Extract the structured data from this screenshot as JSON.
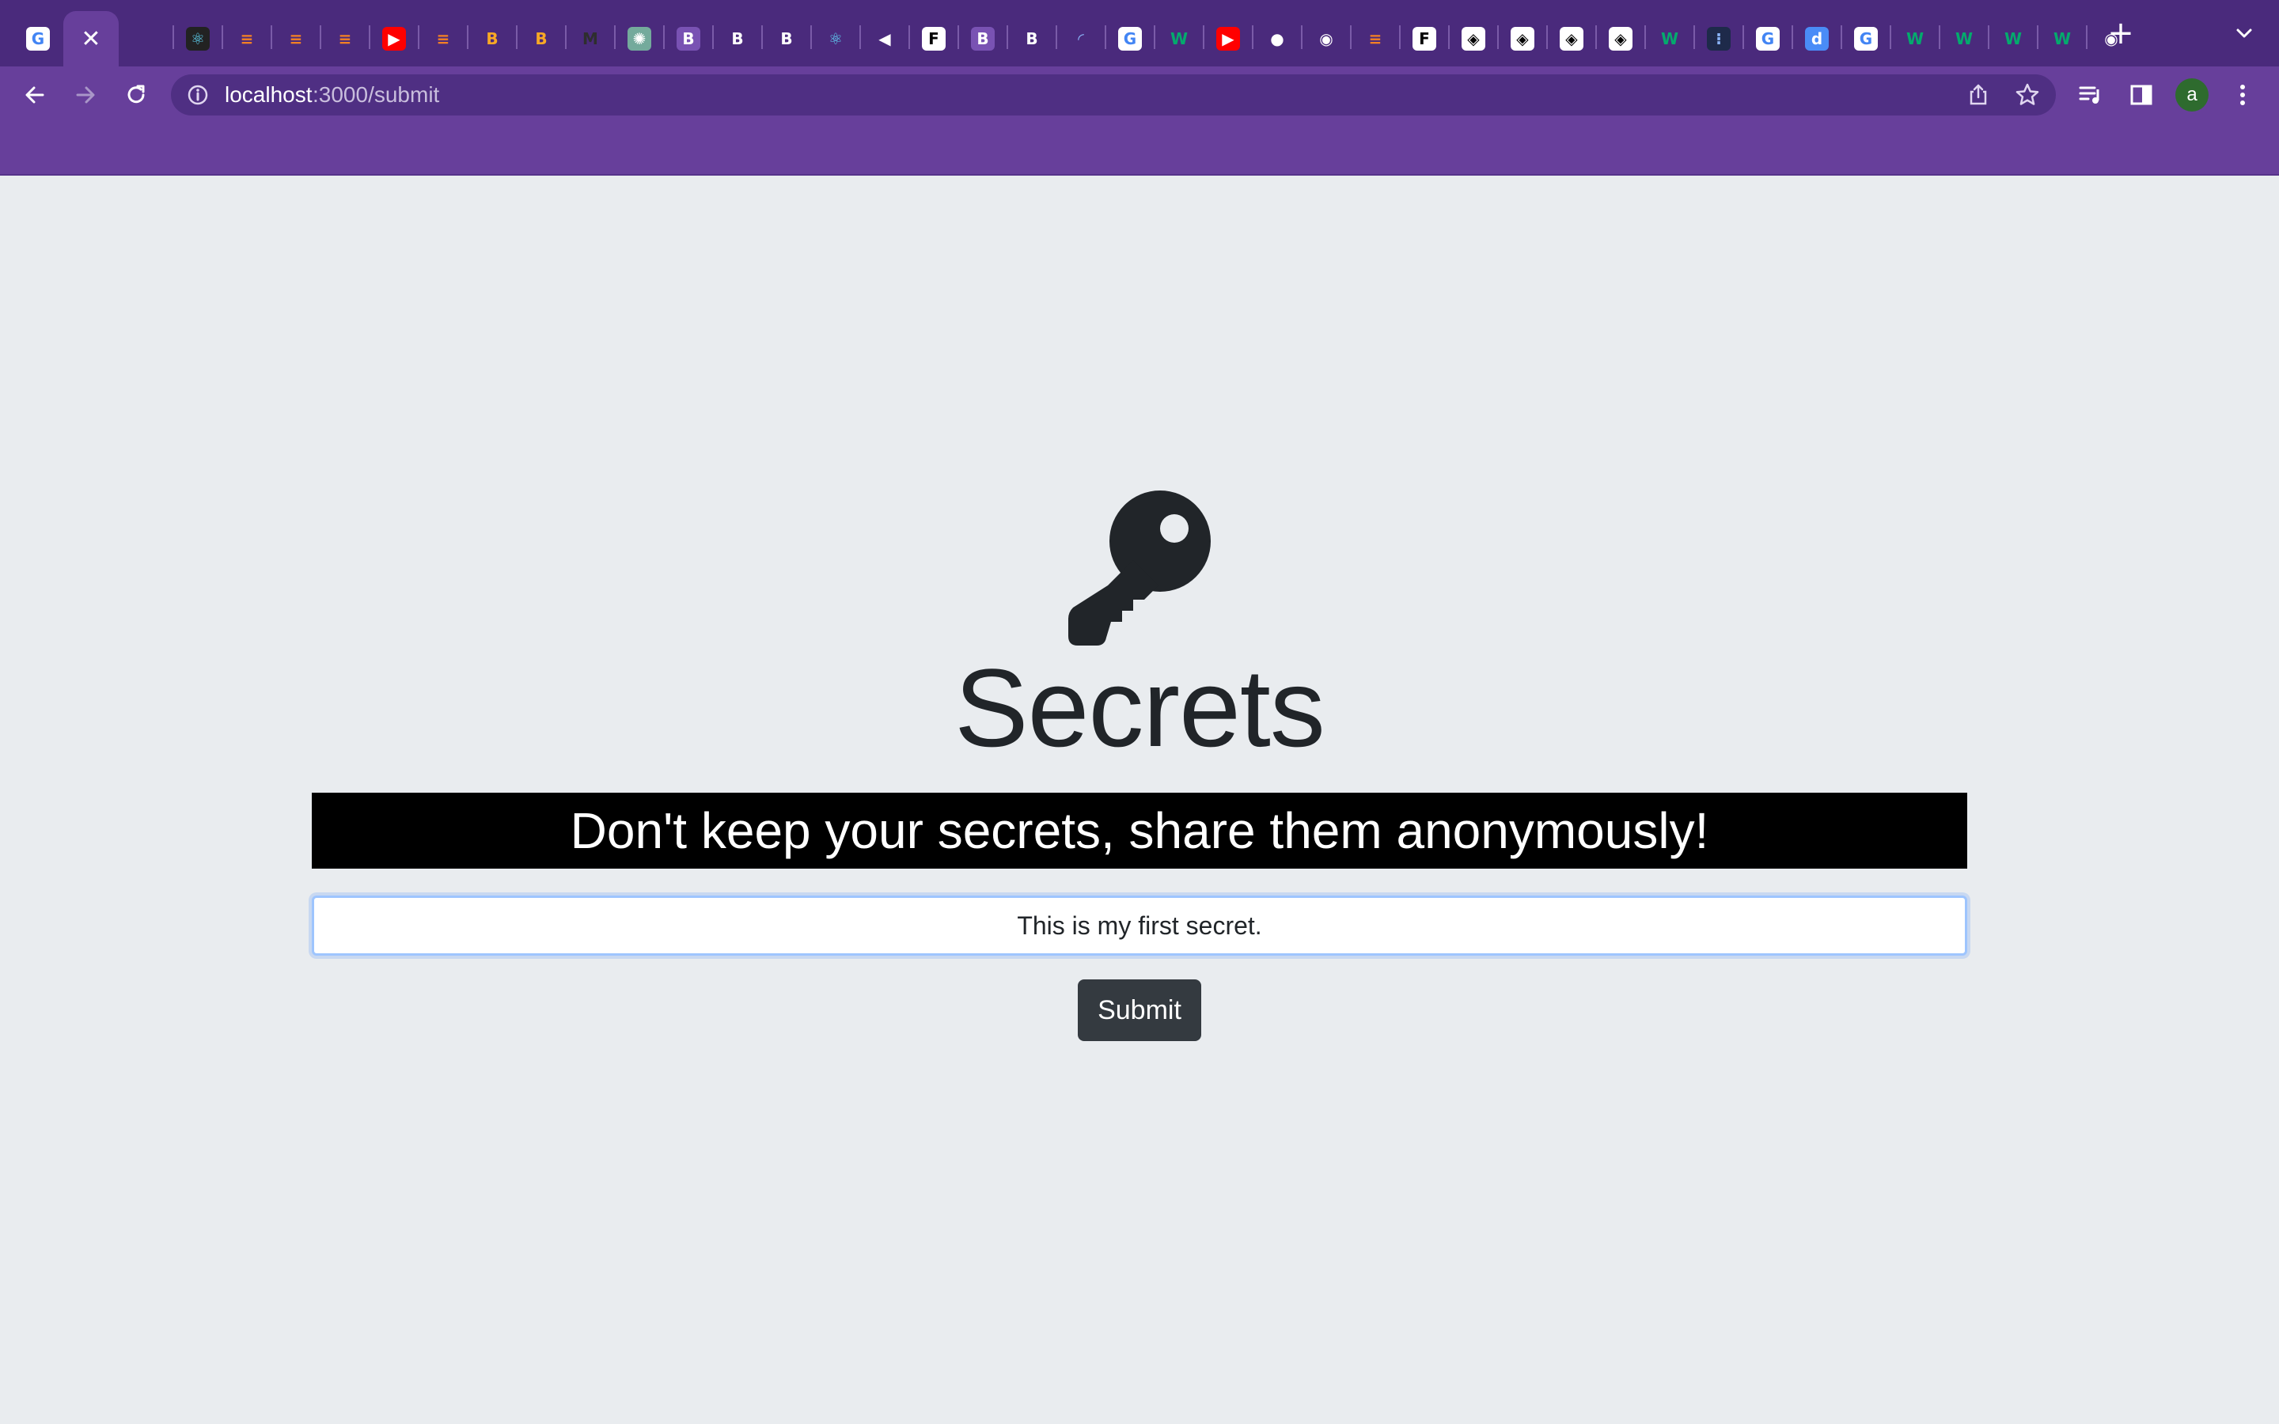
{
  "browser": {
    "tabs": [
      {
        "icon": "google-icon",
        "label": "G",
        "color": "#ffffff",
        "fg": "#4285f4"
      },
      {
        "icon": "close-icon",
        "label": "✕",
        "active": true
      },
      {
        "icon": "react-icon",
        "label": "⚛",
        "color": "#222222",
        "fg": "#61dafb"
      },
      {
        "icon": "stackoverflow-icon",
        "label": "≡",
        "color": "transparent",
        "fg": "#f48024"
      },
      {
        "icon": "stackoverflow-icon",
        "label": "≡",
        "color": "transparent",
        "fg": "#f48024"
      },
      {
        "icon": "stackoverflow-icon",
        "label": "≡",
        "color": "transparent",
        "fg": "#f48024"
      },
      {
        "icon": "youtube-icon",
        "label": "▶",
        "color": "#ff0000",
        "fg": "#ffffff"
      },
      {
        "icon": "stackoverflow-icon",
        "label": "≡",
        "color": "transparent",
        "fg": "#f48024"
      },
      {
        "icon": "app-icon",
        "label": "B",
        "color": "transparent",
        "fg": "#f9a825"
      },
      {
        "icon": "app-icon",
        "label": "B",
        "color": "transparent",
        "fg": "#f9a825"
      },
      {
        "icon": "app-icon",
        "label": "M",
        "color": "transparent",
        "fg": "#2e2e2e"
      },
      {
        "icon": "chatgpt-icon",
        "label": "✺",
        "color": "#74aa9c",
        "fg": "#ffffff"
      },
      {
        "icon": "bootstrap-icon",
        "label": "B",
        "color": "#7952b3",
        "fg": "#ffffff"
      },
      {
        "icon": "bootstrap-icon",
        "label": "B",
        "color": "transparent",
        "fg": "#ffffff"
      },
      {
        "icon": "bootstrap-icon",
        "label": "B",
        "color": "transparent",
        "fg": "#ffffff"
      },
      {
        "icon": "react-icon",
        "label": "⚛",
        "color": "transparent",
        "fg": "#61dafb"
      },
      {
        "icon": "audio-icon",
        "label": "◀",
        "color": "transparent",
        "fg": "#ffffff"
      },
      {
        "icon": "frontend-mentor-icon",
        "label": "F",
        "color": "#ffffff",
        "fg": "#000000"
      },
      {
        "icon": "bootstrap-icon",
        "label": "B",
        "color": "#7952b3",
        "fg": "#ffffff"
      },
      {
        "icon": "bootstrap-icon",
        "label": "B",
        "color": "transparent",
        "fg": "#ffffff"
      },
      {
        "icon": "loading-icon",
        "label": "◜",
        "color": "transparent",
        "fg": "#8ab4f8"
      },
      {
        "icon": "google-icon",
        "label": "G",
        "color": "#ffffff",
        "fg": "#4285f4"
      },
      {
        "icon": "w3schools-icon",
        "label": "W",
        "color": "transparent",
        "fg": "#04aa6d"
      },
      {
        "icon": "youtube-icon",
        "label": "▶",
        "color": "#ff0000",
        "fg": "#ffffff"
      },
      {
        "icon": "globe-icon",
        "label": "●",
        "color": "transparent",
        "fg": "#ffffff"
      },
      {
        "icon": "chrome-icon",
        "label": "◉",
        "color": "transparent",
        "fg": "#ffffff"
      },
      {
        "icon": "stackoverflow-icon",
        "label": "≡",
        "color": "transparent",
        "fg": "#f48024"
      },
      {
        "icon": "frontend-mentor-icon",
        "label": "F",
        "color": "#ffffff",
        "fg": "#000000"
      },
      {
        "icon": "codepen-icon",
        "label": "◈",
        "color": "#ffffff",
        "fg": "#000000"
      },
      {
        "icon": "codepen-icon",
        "label": "◈",
        "color": "#ffffff",
        "fg": "#000000"
      },
      {
        "icon": "codepen-icon",
        "label": "◈",
        "color": "#ffffff",
        "fg": "#000000"
      },
      {
        "icon": "codepen-icon",
        "label": "◈",
        "color": "#ffffff",
        "fg": "#000000"
      },
      {
        "icon": "w3schools-icon",
        "label": "W",
        "color": "transparent",
        "fg": "#04aa6d"
      },
      {
        "icon": "app-icon",
        "label": "⁝",
        "color": "#1e2a4a",
        "fg": "#8ab4f8"
      },
      {
        "icon": "google-icon",
        "label": "G",
        "color": "#ffffff",
        "fg": "#4285f4"
      },
      {
        "icon": "d-icon",
        "label": "d",
        "color": "#4a8cf7",
        "fg": "#ffffff"
      },
      {
        "icon": "google-icon",
        "label": "G",
        "color": "#ffffff",
        "fg": "#4285f4"
      },
      {
        "icon": "w3schools-icon",
        "label": "W",
        "color": "transparent",
        "fg": "#04aa6d"
      },
      {
        "icon": "w3schools-icon",
        "label": "W",
        "color": "transparent",
        "fg": "#04aa6d"
      },
      {
        "icon": "w3schools-icon",
        "label": "W",
        "color": "transparent",
        "fg": "#04aa6d"
      },
      {
        "icon": "w3schools-icon",
        "label": "W",
        "color": "transparent",
        "fg": "#04aa6d"
      },
      {
        "icon": "chrome-icon",
        "label": "◉",
        "color": "transparent",
        "fg": "#ffffff"
      }
    ],
    "new_tab_label": "+",
    "url_host": "localhost",
    "url_path": ":3000/submit",
    "profile_initial": "a",
    "colors": {
      "frame": "#4a2a7c",
      "toolbar": "#673f9b",
      "omnibox": "#4f2f83"
    }
  },
  "page": {
    "title": "Secrets",
    "tagline": "Don't keep your secrets, share them anonymously!",
    "secret_value": "This is my first secret.",
    "submit_label": "Submit",
    "colors": {
      "background": "#e9ecef",
      "tagline_bg": "#000000",
      "button": "#343a40"
    }
  }
}
